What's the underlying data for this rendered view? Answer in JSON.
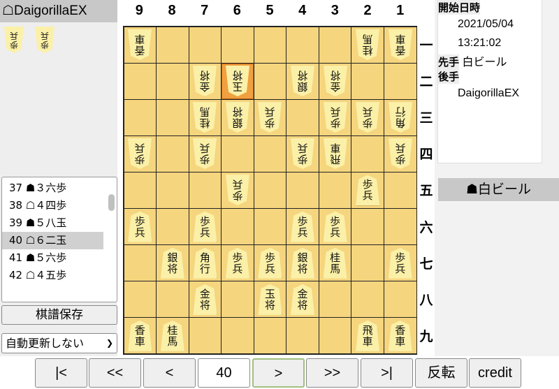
{
  "gote_header": "☖DaigorillaEX",
  "gote_hand": [
    "歩兵",
    "歩兵"
  ],
  "sente_hand": [],
  "column_labels": [
    "9",
    "8",
    "7",
    "6",
    "5",
    "4",
    "3",
    "2",
    "1"
  ],
  "rank_labels": [
    "一",
    "二",
    "三",
    "四",
    "五",
    "六",
    "七",
    "八",
    "九"
  ],
  "last_move_square": "6二",
  "board": [
    [
      "v香車",
      "",
      "",
      "",
      "",
      "",
      "",
      "v桂馬",
      "v香車"
    ],
    [
      "",
      "",
      "v金将",
      "v玉将",
      "",
      "v銀将",
      "v金将",
      "",
      ""
    ],
    [
      "",
      "",
      "v桂馬",
      "v銀将",
      "v歩兵",
      "",
      "v歩兵",
      "v歩兵",
      "v角行"
    ],
    [
      "v歩兵",
      "",
      "v歩兵",
      "",
      "",
      "v歩兵",
      "v飛車",
      "",
      "v歩兵"
    ],
    [
      "",
      "",
      "",
      "v歩兵",
      "",
      "",
      "",
      "+歩兵",
      ""
    ],
    [
      "+歩兵",
      "",
      "+歩兵",
      "",
      "",
      "+歩兵",
      "+歩兵",
      "",
      ""
    ],
    [
      "",
      "+銀将",
      "+角行",
      "+歩兵",
      "+歩兵",
      "+銀将",
      "+桂馬",
      "",
      "+歩兵"
    ],
    [
      "",
      "",
      "+金将",
      "",
      "+玉将",
      "+金将",
      "",
      "",
      ""
    ],
    [
      "+香車",
      "+桂馬",
      "",
      "",
      "",
      "",
      "",
      "+飛車",
      "+香車"
    ]
  ],
  "moves": [
    {
      "text": "37 ☗３六歩",
      "selected": false
    },
    {
      "text": "38 ☖４四歩",
      "selected": false
    },
    {
      "text": "39 ☗５八玉",
      "selected": false
    },
    {
      "text": "40 ☖６二玉",
      "selected": true
    },
    {
      "text": "41 ☗５六歩",
      "selected": false
    },
    {
      "text": "42 ☖４五歩",
      "selected": false
    }
  ],
  "save_button": "棋譜保存",
  "auto_update": "自動更新しない",
  "info": {
    "start_label": "開始日時",
    "start_date": "2021/05/04",
    "start_time": "13:21:02",
    "sente_label": "先手",
    "sente_name": "白ビール",
    "gote_label": "後手",
    "gote_name": "DaigorillaEX"
  },
  "turn_indicator": "☗白ビール",
  "nav": {
    "first": "|<",
    "back10": "<<",
    "back": "<",
    "move_number": "40",
    "forward": ">",
    "forward10": ">>",
    "last": ">|",
    "flip": "反転",
    "credit": "credit"
  },
  "colors": {
    "board": "#f5d57e",
    "highlight": "#f0a040",
    "piece": "#fbf0a8"
  }
}
